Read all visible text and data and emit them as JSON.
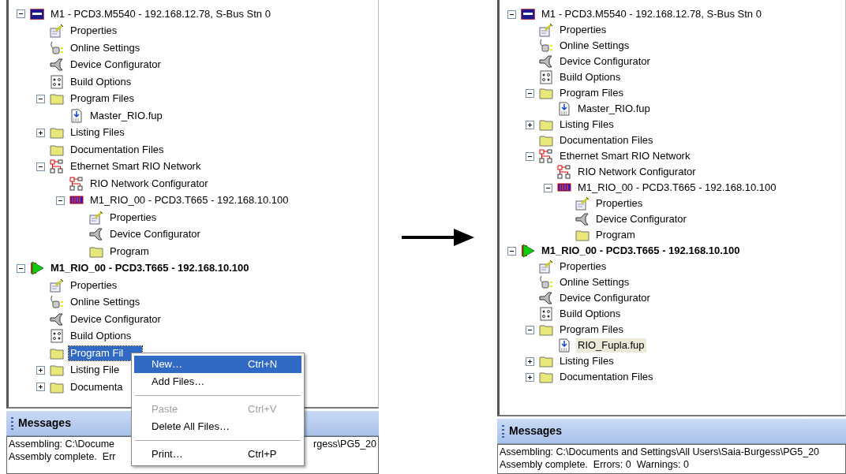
{
  "panels": [
    {
      "tree": [
        {
          "label": "M1 - PCD3.M5540 - 192.168.12.78, S-Bus Stn 0",
          "kind": "pcd",
          "bold": false,
          "expanded": true,
          "selected": false,
          "children": [
            {
              "label": "Properties",
              "kind": "properties",
              "selected": false
            },
            {
              "label": "Online Settings",
              "kind": "online",
              "selected": false
            },
            {
              "label": "Device Configurator",
              "kind": "configurator",
              "selected": false
            },
            {
              "label": "Build Options",
              "kind": "build",
              "selected": false
            },
            {
              "label": "Program Files",
              "kind": "folder",
              "expanded": true,
              "selected": false,
              "children": [
                {
                  "label": "Master_RIO.fup",
                  "kind": "file",
                  "selected": false
                }
              ]
            },
            {
              "label": "Listing Files",
              "kind": "folder",
              "expanded": false,
              "selected": false
            },
            {
              "label": "Documentation Files",
              "kind": "folder",
              "selected": false
            },
            {
              "label": "Ethernet Smart RIO Network",
              "kind": "network",
              "expanded": true,
              "selected": false,
              "children": [
                {
                  "label": "RIO Network Configurator",
                  "kind": "network",
                  "selected": false
                },
                {
                  "label": "M1_RIO_00 - PCD3.T665 - 192.168.10.100",
                  "kind": "rio",
                  "expanded": true,
                  "selected": false,
                  "children": [
                    {
                      "label": "Properties",
                      "kind": "properties",
                      "selected": false
                    },
                    {
                      "label": "Device Configurator",
                      "kind": "configurator",
                      "selected": false
                    },
                    {
                      "label": "Program",
                      "kind": "folder",
                      "selected": false
                    }
                  ]
                }
              ]
            }
          ]
        },
        {
          "label": "M1_RIO_00 - PCD3.T665 - 192.168.10.100",
          "kind": "play",
          "bold": true,
          "expanded": true,
          "selected": false,
          "children": [
            {
              "label": "Properties",
              "kind": "properties",
              "selected": false
            },
            {
              "label": "Online Settings",
              "kind": "online",
              "selected": false
            },
            {
              "label": "Device Configurator",
              "kind": "configurator",
              "selected": false
            },
            {
              "label": "Build Options",
              "kind": "build",
              "selected": false
            },
            {
              "label": "Program Fil",
              "kind": "folder",
              "selected": true
            },
            {
              "label": "Listing File",
              "kind": "folder",
              "expanded": false,
              "selected": false
            },
            {
              "label": "Documenta",
              "kind": "folder",
              "expanded": false,
              "selected": false
            }
          ]
        }
      ],
      "context_menu": {
        "items": [
          {
            "kind": "item",
            "label": "New…",
            "shortcut": "Ctrl+N",
            "disabled": false,
            "selected": true
          },
          {
            "kind": "item",
            "label": "Add Files…",
            "disabled": false,
            "selected": false
          },
          {
            "kind": "separator"
          },
          {
            "kind": "item",
            "label": "Paste",
            "shortcut": "Ctrl+V",
            "disabled": true,
            "selected": false
          },
          {
            "kind": "item",
            "label": "Delete All Files…",
            "disabled": false,
            "selected": false
          },
          {
            "kind": "separator"
          },
          {
            "kind": "item",
            "label": "Print…",
            "shortcut": "Ctrl+P",
            "disabled": false,
            "selected": false
          }
        ]
      },
      "messages": {
        "title": "Messages",
        "lines": [
          {
            "text": "Assembling: C:\\Docume",
            "tail": "rgess\\PG5_20"
          },
          {
            "text": "Assembly complete.  Err"
          }
        ]
      }
    },
    {
      "tree": [
        {
          "label": "M1 - PCD3.M5540 - 192.168.12.78, S-Bus Stn 0",
          "kind": "pcd",
          "bold": false,
          "expanded": true,
          "selected": false,
          "children": [
            {
              "label": "Properties",
              "kind": "properties",
              "selected": false
            },
            {
              "label": "Online Settings",
              "kind": "online",
              "selected": false
            },
            {
              "label": "Device Configurator",
              "kind": "configurator",
              "selected": false
            },
            {
              "label": "Build Options",
              "kind": "build",
              "selected": false
            },
            {
              "label": "Program Files",
              "kind": "folder",
              "expanded": true,
              "selected": false,
              "children": [
                {
                  "label": "Master_RIO.fup",
                  "kind": "file",
                  "selected": false
                }
              ]
            },
            {
              "label": "Listing Files",
              "kind": "folder",
              "expanded": false,
              "selected": false
            },
            {
              "label": "Documentation Files",
              "kind": "folder",
              "selected": false
            },
            {
              "label": "Ethernet Smart RIO Network",
              "kind": "network",
              "expanded": true,
              "selected": false,
              "children": [
                {
                  "label": "RIO Network Configurator",
                  "kind": "network",
                  "selected": false
                },
                {
                  "label": "M1_RIO_00 - PCD3.T665 - 192.168.10.100",
                  "kind": "rio",
                  "expanded": true,
                  "selected": false,
                  "children": [
                    {
                      "label": "Properties",
                      "kind": "properties",
                      "selected": false
                    },
                    {
                      "label": "Device Configurator",
                      "kind": "configurator",
                      "selected": false
                    },
                    {
                      "label": "Program",
                      "kind": "folder",
                      "selected": false
                    }
                  ]
                }
              ]
            }
          ]
        },
        {
          "label": "M1_RIO_00 - PCD3.T665 - 192.168.10.100",
          "kind": "play",
          "bold": true,
          "expanded": true,
          "selected": false,
          "children": [
            {
              "label": "Properties",
              "kind": "properties",
              "selected": false
            },
            {
              "label": "Online Settings",
              "kind": "online",
              "selected": false
            },
            {
              "label": "Device Configurator",
              "kind": "configurator",
              "selected": false
            },
            {
              "label": "Build Options",
              "kind": "build",
              "selected": false
            },
            {
              "label": "Program Files",
              "kind": "folder",
              "expanded": true,
              "selected": false,
              "children": [
                {
                  "label": "RIO_Fupla.fup",
                  "kind": "file",
                  "selected": true
                }
              ]
            },
            {
              "label": "Listing Files",
              "kind": "folder",
              "expanded": false,
              "selected": false
            },
            {
              "label": "Documentation Files",
              "kind": "folder",
              "expanded": false,
              "selected": false
            }
          ]
        }
      ],
      "messages": {
        "title": "Messages",
        "lines": [
          {
            "text": "Assembling: C:\\Documents and Settings\\All Users\\Saia-Burgess\\PG5_20"
          },
          {
            "text": "Assembly complete.  Errors: 0  Warnings: 0"
          }
        ]
      }
    }
  ]
}
